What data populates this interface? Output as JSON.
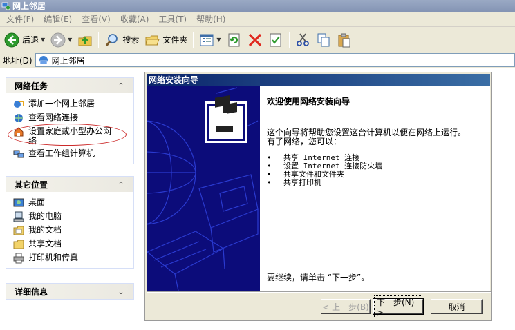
{
  "window": {
    "title": "网上邻居"
  },
  "menu": [
    "文件(F)",
    "编辑(E)",
    "查看(V)",
    "收藏(A)",
    "工具(T)",
    "帮助(H)"
  ],
  "toolbar": {
    "back_label": "后退",
    "search_label": "搜索",
    "folders_label": "文件夹"
  },
  "address": {
    "label": "地址(D)",
    "value": "网上邻居"
  },
  "network_tasks": {
    "title": "网络任务",
    "items": [
      "添加一个网上邻居",
      "查看网络连接",
      "设置家庭或小型办公网络",
      "查看工作组计算机"
    ]
  },
  "other_places": {
    "title": "其它位置",
    "items": [
      "桌面",
      "我的电脑",
      "我的文档",
      "共享文档",
      "打印机和传真"
    ]
  },
  "details": {
    "title": "详细信息"
  },
  "wizard": {
    "title": "网络安装向导",
    "heading": "欢迎使用网络安装向导",
    "desc_line1": "这个向导将帮助您设置这台计算机以便在网络上运行。",
    "desc_line2": "有了网络，您可以：",
    "list": [
      "共享 Internet 连接",
      "设置 Internet 连接防火墙",
      "共享文件和文件夹",
      "共享打印机"
    ],
    "continue_text": "要继续，请单击 “下一步”。",
    "back_button": "< 上一步(B)",
    "next_button": "下一步(N) >",
    "cancel_button": "取消"
  },
  "colors": {
    "wizard_art_bg": "#0c0c7a",
    "highlight_ring": "#cc2a2a",
    "title_bar": "#0a246a"
  }
}
